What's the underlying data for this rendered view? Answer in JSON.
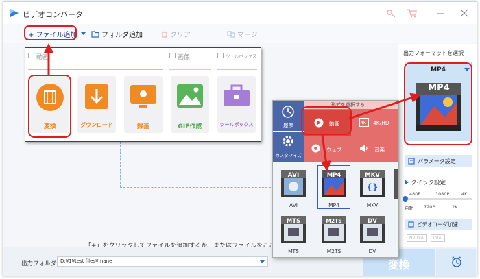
{
  "app": {
    "title": "ビデオコンバータ"
  },
  "toolbar": {
    "add_file": "+ ファイル追加",
    "add_folder": "フォルダ追加",
    "clear": "クリア",
    "merge": "マージ"
  },
  "categories": {
    "video": "動画",
    "image": "画像",
    "toolbox": "ツールボックス"
  },
  "features": [
    {
      "label": "変換"
    },
    {
      "label": "ダウンロード"
    },
    {
      "label": "録画"
    },
    {
      "label": "GIF作成"
    },
    {
      "label": "ツールボックス"
    }
  ],
  "main": {
    "hint": "「+」をクリックしてファイルを追加するか、またはファイルをここまでド"
  },
  "format_panel": {
    "header": "形式を選択する",
    "side": {
      "history": "履歴",
      "custom": "カスタマイズ"
    },
    "tabs": {
      "video": "動画",
      "hd": "4K/HD",
      "web": "ウェブ",
      "audio": "音楽"
    },
    "formats": [
      "AVI",
      "MP4",
      "MKV",
      "MTS",
      "M2TS",
      "DV"
    ]
  },
  "output": {
    "title": "出力フォーマットを選択",
    "selected": "MP4",
    "param": "パラメータ設定",
    "quick": "クイック設定",
    "scale_top": [
      "480P",
      "1080P",
      "4K"
    ],
    "scale_bottom": [
      "自動",
      "720P",
      "2K"
    ],
    "accel": "ビデオコーダ加速",
    "gpu": [
      "NVIDIA",
      "Intel"
    ]
  },
  "bottom": {
    "folder_label": "出力フォルダ：",
    "folder_path": "D:¥1¥test files¥mane",
    "convert": "変換"
  },
  "colors": {
    "accent": "#1b6fd1",
    "orange": "#f08a24",
    "highlight": "#e01e1e",
    "panel_red": "#e36e6c",
    "panel_blue": "#4b66a8"
  }
}
